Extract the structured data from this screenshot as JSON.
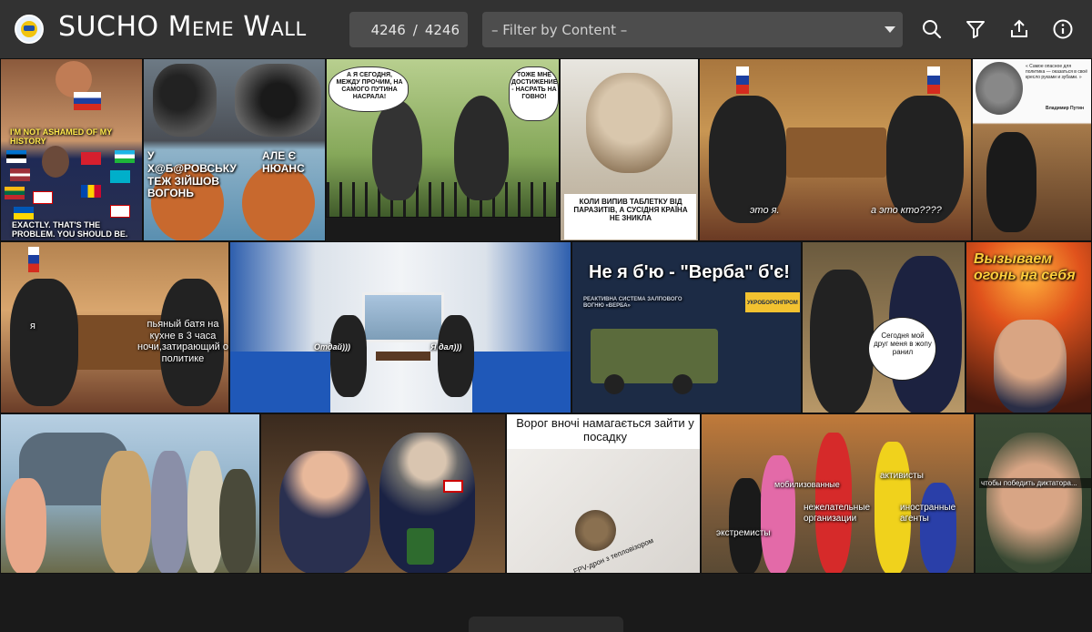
{
  "header": {
    "title": "SUCHO Meme Wall",
    "counter_current": "4246",
    "counter_sep": "/",
    "counter_total": "4246",
    "filter_placeholder": "– Filter by Content –",
    "icons": [
      "search-icon",
      "filter-icon",
      "share-icon",
      "info-icon"
    ]
  },
  "colors": {
    "header_bg": "#323232",
    "input_bg": "#4d4d4d",
    "page_bg": "#1a1a1a"
  },
  "memes": {
    "m1": {
      "top": "I'M NOT ASHAMED OF MY HISTORY",
      "bottom": "EXACTLY. THAT'S THE PROBLEM. YOU SHOULD BE."
    },
    "m2": {
      "left": "У Х@Б@РОВСЬКУ ТЕЖ ЗІЙШОВ ВОГОНЬ",
      "right": "АЛЕ Є НЮАНС"
    },
    "m3": {
      "left": "А Я СЕГОДНЯ, МЕЖДУ ПРОЧИМ, НА САМОГО ПУТИНА НАСРАЛА!",
      "right": "ТОЖЕ МНЕ ДОСТИЖЕНИЕ - НАСРАТЬ НА ГОВНО!"
    },
    "m4": {
      "bottom": "КОЛИ ВИПИВ ТАБЛЕТКУ ВІД ПАРАЗИТІВ, А СУСІДНЯ КРАЇНА НЕ ЗНИКЛА"
    },
    "m5": {
      "left": "это я.",
      "right": "а это кто????"
    },
    "m6": {
      "quote": "« Самое опасное для политика — оказаться в своё кресло руками и зубами. »",
      "author": "Владимир Путин"
    },
    "m7": {
      "left": "я",
      "right": "пьяный батя на кухне в 3 часа ночи,затирающий о политике"
    },
    "m8": {
      "left": "Отдай)))",
      "right": "Я дал)))"
    },
    "m9": {
      "title": "Не я б'ю - \"Верба\" б'є!",
      "sub": "РЕАКТИВНА СИСТЕМА ЗАЛПОВОГО ВОГНЮ «ВЕРБА»",
      "brand": "УКРОБОРОНПРОМ"
    },
    "m10": {
      "bubble": "Сегодня мой друг меня в жопу ранил"
    },
    "m11": {
      "title": "Вызываем огонь на себя"
    },
    "m14": {
      "title": "Ворог вночі намагається зайти у посадку",
      "label": "FPV-дрон з тепловізором"
    },
    "m15": {
      "l1": "мобилизованные",
      "l2": "активисты",
      "l3": "нежелательные организации",
      "l4": "иностранные агенты",
      "l5": "экстремисты"
    },
    "m16": {
      "caption": "чтобы победить диктатора..."
    }
  }
}
